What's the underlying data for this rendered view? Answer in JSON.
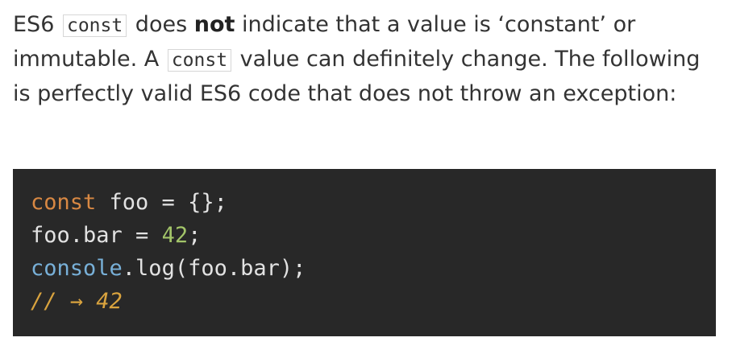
{
  "paragraph": {
    "t1": "ES6 ",
    "code1": "const",
    "t2": " does ",
    "bold": "not",
    "t3": " indicate that a value is ‘constant’ or immutable. A ",
    "code2": "const",
    "t4": " value can definitely change. The following is perfectly valid ES6 code that does not throw an exception:"
  },
  "code": {
    "line1": {
      "keyword": "const",
      "rest": " foo = {};"
    },
    "line2": {
      "pre": "foo.bar = ",
      "number": "42",
      "post": ";"
    },
    "line3": {
      "global": "console",
      "rest": ".log(foo.bar);"
    },
    "line4": {
      "comment": "// → 42"
    }
  },
  "colors": {
    "page_background": "#ffffff",
    "text": "#333333",
    "code_background": "#282828",
    "keyword": "#d88843",
    "number": "#a3c569",
    "global": "#78b0d8",
    "comment": "#d9a33e"
  }
}
